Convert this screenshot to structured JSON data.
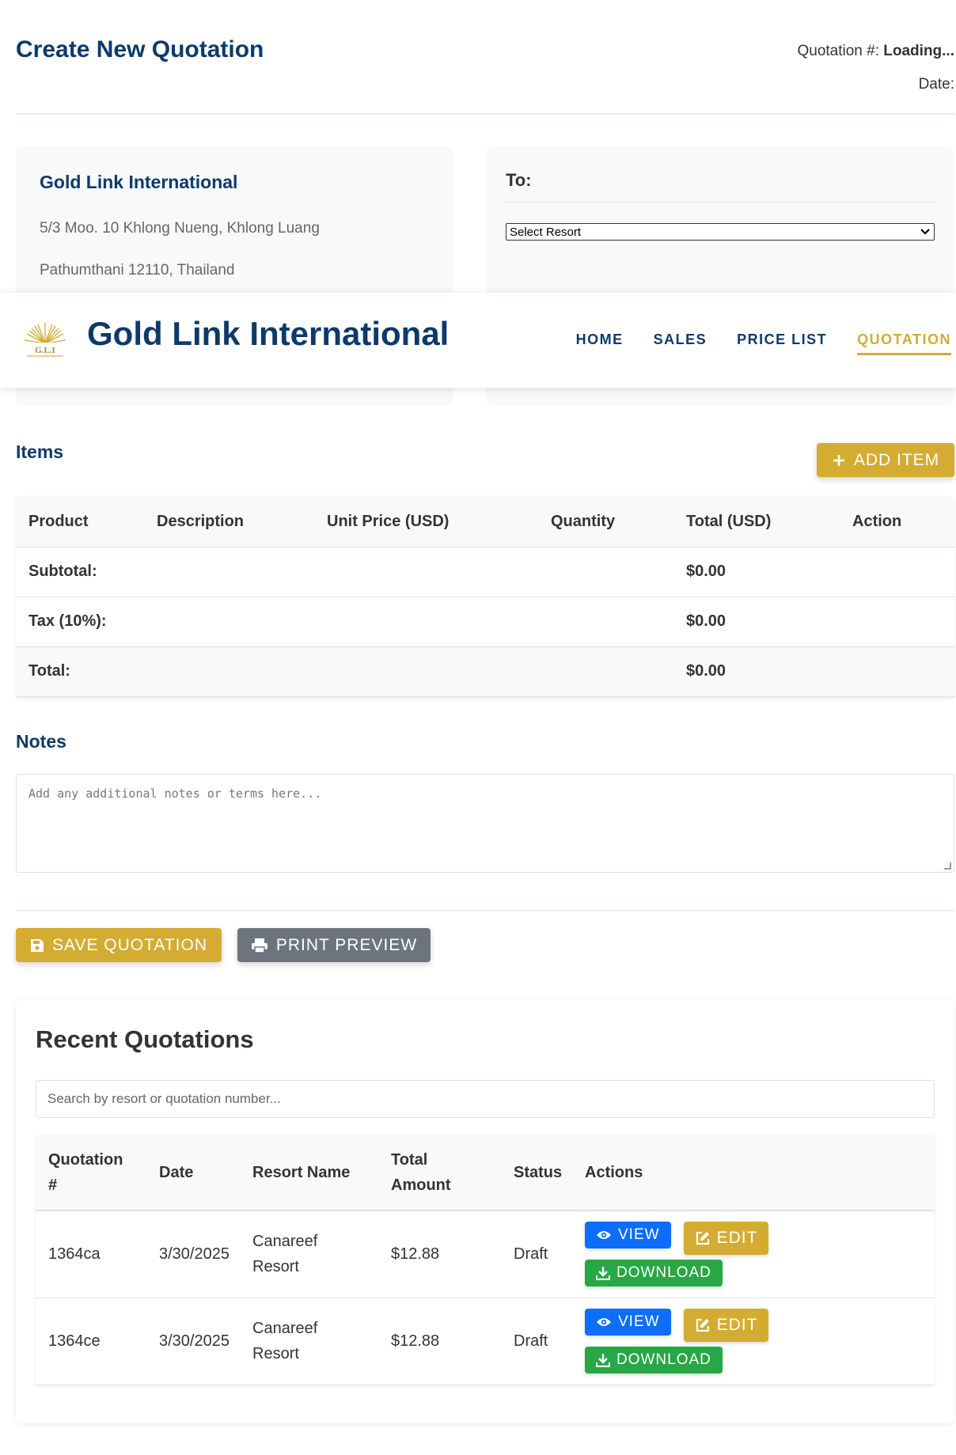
{
  "header": {
    "title": "Create New Quotation",
    "quotation_label": "Quotation #:",
    "quotation_value": "Loading...",
    "date_label": "Date:"
  },
  "from": {
    "company": "Gold Link International",
    "address_line1": "5/3 Moo. 10 Khlong Nueng, Khlong Luang",
    "address_line2": "Pathumthani 12110, Thailand"
  },
  "to": {
    "label": "To:",
    "select_value": "Select Resort"
  },
  "navbar": {
    "logo_text": "G.L.I",
    "brand": "Gold Link International",
    "links": [
      "HOME",
      "SALES",
      "PRICE LIST",
      "QUOTATION"
    ],
    "active": "QUOTATION"
  },
  "items": {
    "title": "Items",
    "add_button": "ADD ITEM",
    "columns": [
      "Product",
      "Description",
      "Unit Price (USD)",
      "Quantity",
      "Total (USD)",
      "Action"
    ],
    "subtotal_label": "Subtotal:",
    "subtotal_value": "$0.00",
    "tax_label": "Tax (10%):",
    "tax_value": "$0.00",
    "total_label": "Total:",
    "total_value": "$0.00"
  },
  "notes": {
    "title": "Notes",
    "placeholder": "Add any additional notes or terms here..."
  },
  "actions": {
    "save": "SAVE QUOTATION",
    "print": "PRINT PREVIEW"
  },
  "recent": {
    "title": "Recent Quotations",
    "search_placeholder": "Search by resort or quotation number...",
    "columns": {
      "number_a": "Quotation",
      "number_b": "#",
      "date": "Date",
      "resort": "Resort Name",
      "amount_a": "Total",
      "amount_b": "Amount",
      "status": "Status",
      "actions": "Actions"
    },
    "rows": [
      {
        "number": "1364ca",
        "date": "3/30/2025",
        "resort_a": "Canareef",
        "resort_b": "Resort",
        "amount": "$12.88",
        "status": "Draft"
      },
      {
        "number": "1364ce",
        "date": "3/30/2025",
        "resort_a": "Canareef",
        "resort_b": "Resort",
        "amount": "$12.88",
        "status": "Draft"
      }
    ],
    "buttons": {
      "view": "VIEW",
      "edit": "EDIT",
      "download": "DOWNLOAD"
    }
  },
  "colors": {
    "navy": "#0d3a6b",
    "gold": "#d4ac32",
    "blue": "#0d6efd",
    "green": "#28a745",
    "grey": "#6c757d"
  }
}
